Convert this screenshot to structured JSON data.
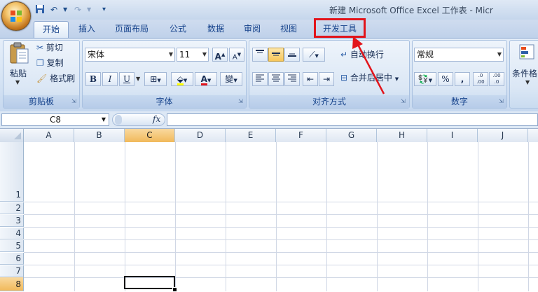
{
  "window": {
    "title": "新建 Microsoft Office Excel 工作表 - Micr"
  },
  "tabs": [
    "开始",
    "插入",
    "页面布局",
    "公式",
    "数据",
    "审阅",
    "视图",
    "开发工具"
  ],
  "clipboard": {
    "paste": "粘贴",
    "cut": "剪切",
    "copy": "复制",
    "format_painter": "格式刷",
    "label": "剪贴板"
  },
  "font": {
    "name": "宋体",
    "size": "11",
    "grow": "A",
    "shrink": "A",
    "bold": "B",
    "italic": "I",
    "underline": "U",
    "font_color": "A",
    "phonetic": "變",
    "label": "字体"
  },
  "alignment": {
    "wrap_text": "自动换行",
    "merge_center": "合并后居中",
    "label": "对齐方式"
  },
  "number": {
    "format": "常规",
    "percent": "%",
    "comma": ",",
    "inc_decimal": ".0 .00",
    "dec_decimal": ".00 .0",
    "label": "数字"
  },
  "styles": {
    "conditional_format": "条件格"
  },
  "formula_bar": {
    "name_box": "C8",
    "fx": "fx"
  },
  "columns": [
    "A",
    "B",
    "C",
    "D",
    "E",
    "F",
    "G",
    "H",
    "I",
    "J"
  ],
  "rows": [
    "1",
    "2",
    "3",
    "4",
    "5",
    "6",
    "7",
    "8"
  ],
  "active_cell": "C8",
  "colors": {
    "highlight": "#e2141b",
    "font_color_bar": "#e2141b",
    "fill_color_bar": "#ffff00",
    "selected_header": "#f1b95a"
  }
}
